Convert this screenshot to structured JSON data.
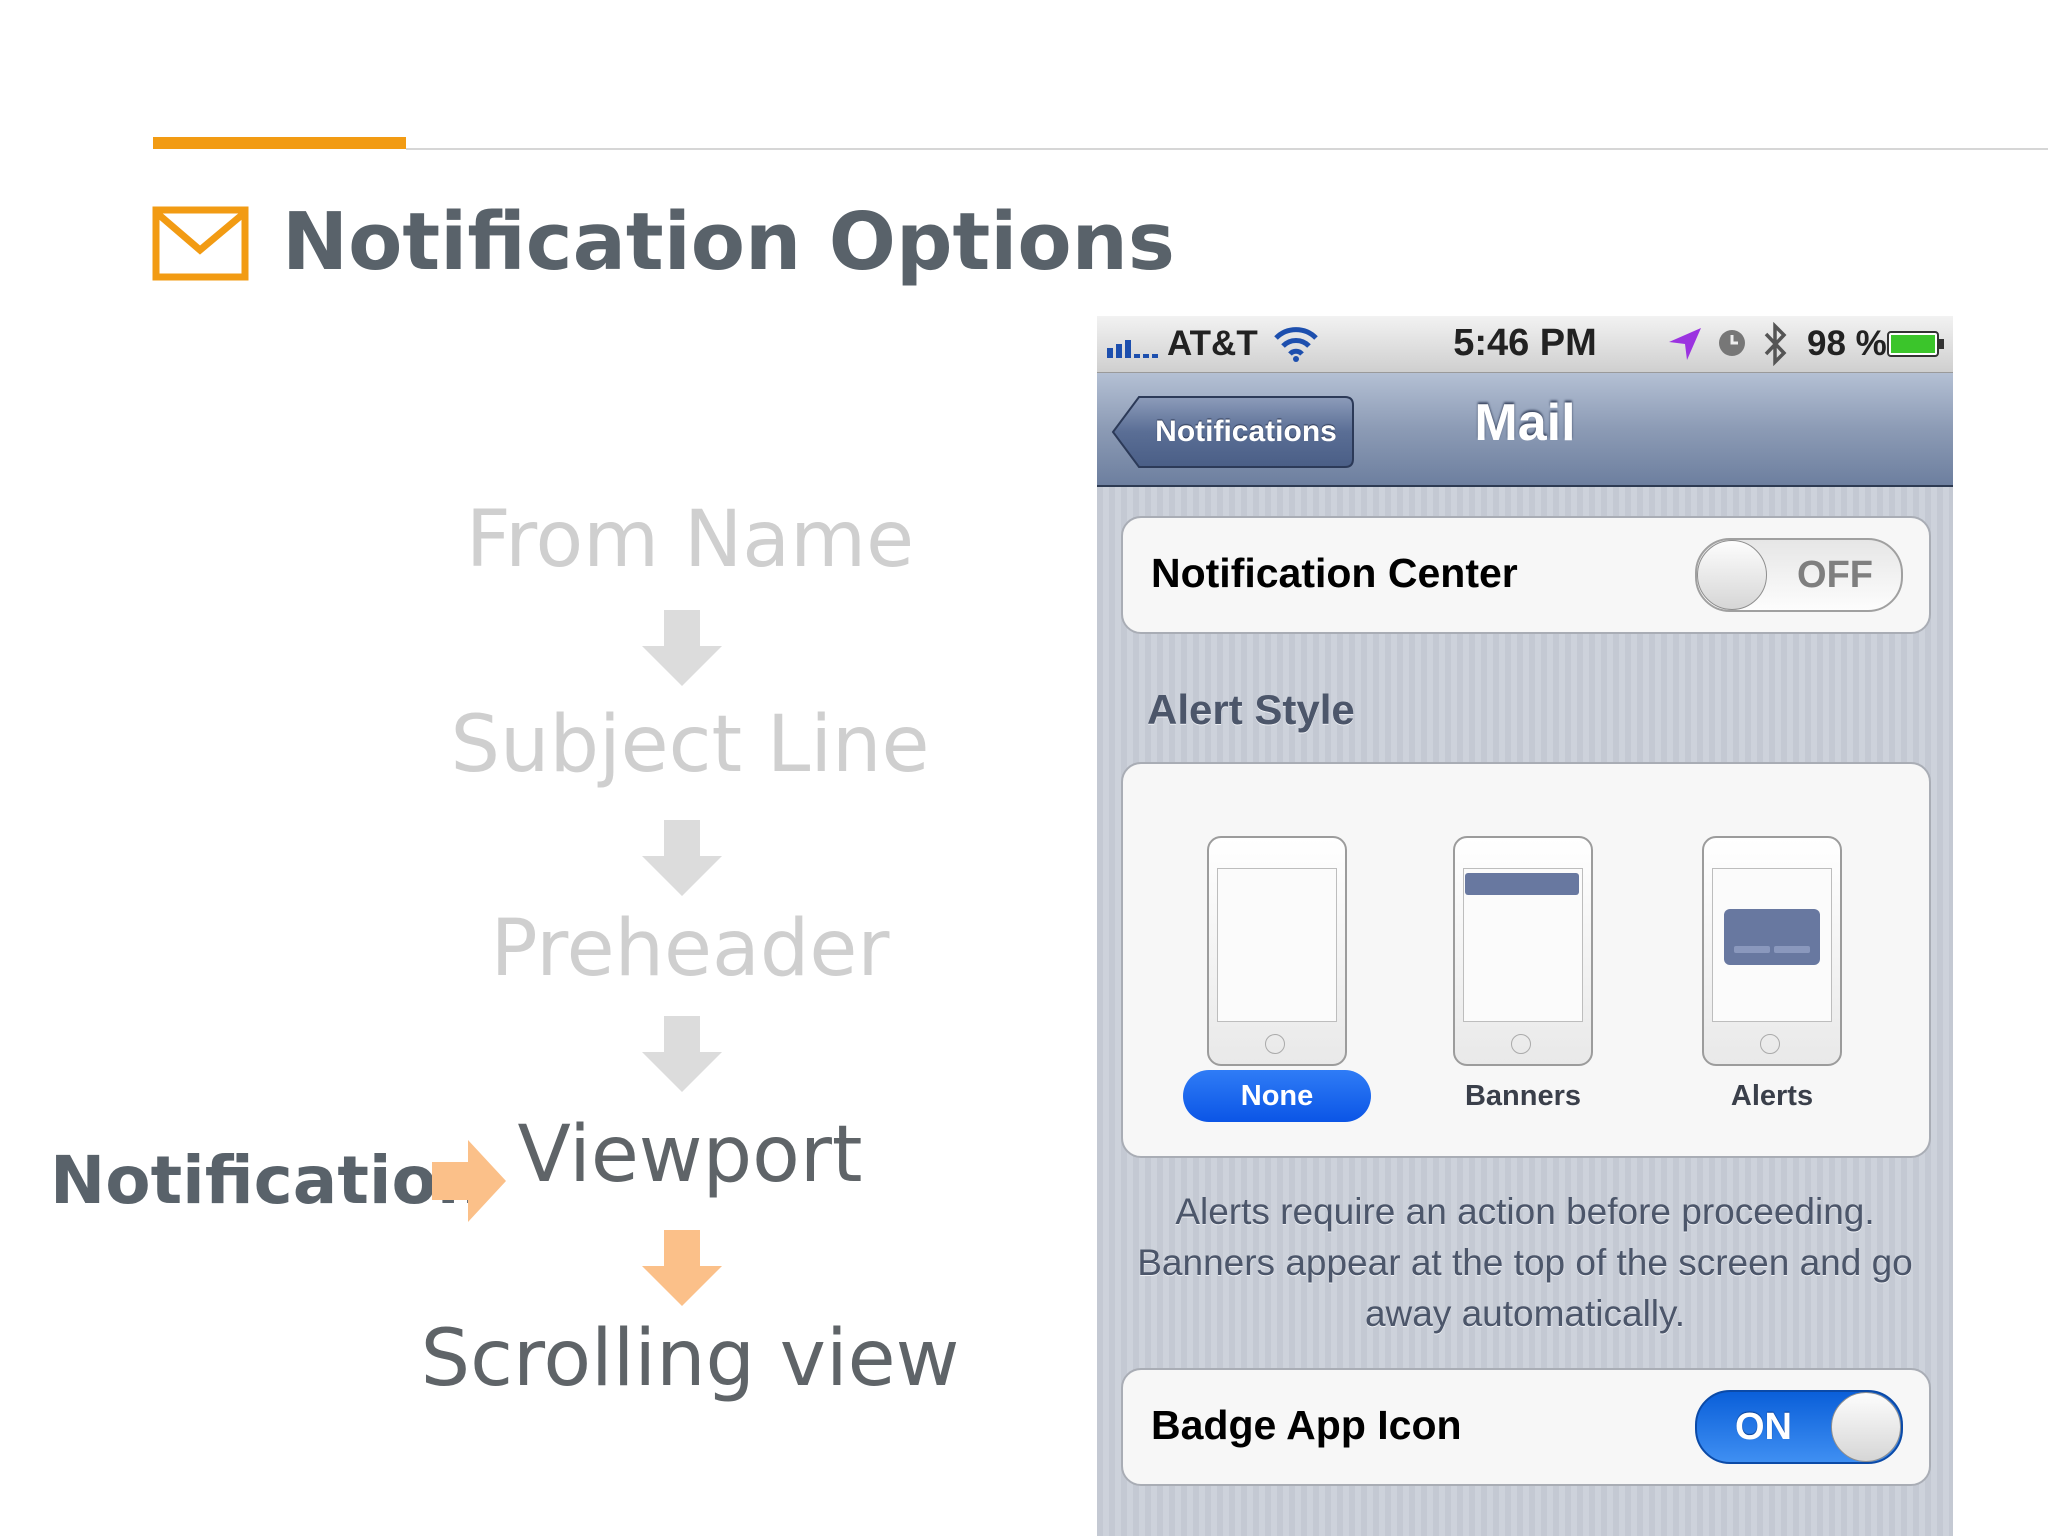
{
  "slide": {
    "title": "Notification Options",
    "accent_color": "#F29B13",
    "title_icon": "envelope-icon"
  },
  "flow": {
    "steps": [
      "From Name",
      "Subject Line",
      "Preheader",
      "Viewport",
      "Scrolling view"
    ],
    "highlighted_step": "Viewport",
    "pointer_label": "Notification"
  },
  "phone": {
    "status_bar": {
      "carrier": "AT&T",
      "time": "5:46 PM",
      "battery": "98 %",
      "icons": [
        "signal-icon",
        "wifi-icon",
        "location-arrow-icon",
        "clock-icon",
        "bluetooth-icon",
        "battery-icon"
      ]
    },
    "nav": {
      "back_label": "Notifications",
      "title": "Mail"
    },
    "notification_center": {
      "label": "Notification Center",
      "state": "OFF"
    },
    "alert_style": {
      "header": "Alert Style",
      "options": [
        "None",
        "Banners",
        "Alerts"
      ],
      "selected": "None",
      "description": "Alerts require an action before proceeding. Banners appear at the top of the screen and go away automatically."
    },
    "badge_app_icon": {
      "label": "Badge App Icon",
      "state": "ON"
    }
  }
}
